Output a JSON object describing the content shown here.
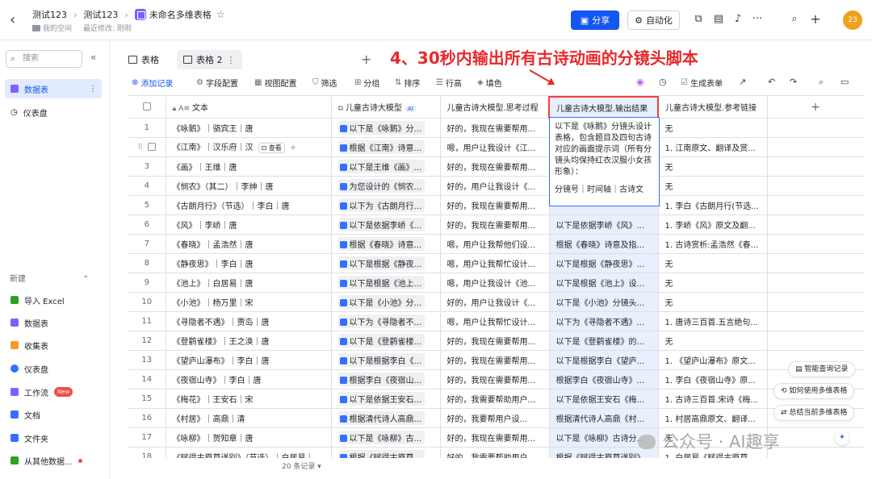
{
  "header": {
    "crumbs": [
      "测试123",
      "测试123",
      "未命名多维表格"
    ],
    "location": "我的空间",
    "modified": "最近修改: 刚刚",
    "share_label": "分享",
    "automation_label": "自动化",
    "avatar_text": "23"
  },
  "sidebar": {
    "search_placeholder": "搜索",
    "items": [
      {
        "label": "数据表",
        "color": "#7b61ff"
      },
      {
        "label": "仪表盘",
        "color": "#1f2329"
      }
    ],
    "new_label": "新建",
    "new_items": [
      {
        "label": "导入 Excel",
        "color": "#2ea121"
      },
      {
        "label": "数据表",
        "color": "#7b61ff"
      },
      {
        "label": "收集表",
        "color": "#f59a23"
      },
      {
        "label": "仪表盘",
        "color": "#3370ff"
      },
      {
        "label": "工作流",
        "color": "#7b61ff"
      },
      {
        "label": "文档",
        "color": "#3370ff"
      },
      {
        "label": "文件夹",
        "color": "#3370ff"
      },
      {
        "label": "从其他数据...",
        "color": "#2ea121"
      }
    ],
    "new_badge": "New"
  },
  "tabs": [
    {
      "label": "表格"
    },
    {
      "label": "表格 2"
    }
  ],
  "toolbar": {
    "add_record": "添加记录",
    "field_config": "字段配置",
    "view_config": "视图配置",
    "filter": "筛选",
    "group": "分组",
    "sort": "排序",
    "row_height": "行高",
    "fill_color": "填色",
    "generate_form": "生成表单"
  },
  "annotation": "4、30秒内输出所有古诗动画的分镜头脚本",
  "table": {
    "columns": [
      "文本",
      "儿童古诗大模型",
      "儿童古诗大模型.思考过程",
      "儿童古诗大模型.输出结果",
      "儿童古诗大模型.参考链接"
    ],
    "ai_tag": "AI",
    "view_label": "查看",
    "rows": [
      {
        "n": "1",
        "text": "《咏鹅》｜骆宾王｜唐",
        "model": "以下是《咏鹅》分...",
        "think": "好的，我现在需要帮用...",
        "out": "",
        "link": "无"
      },
      {
        "n": "",
        "text": "《江南》｜汉乐府｜汉",
        "model": "根据《江南》诗意...",
        "think": "嗯，用户让我设计《江...",
        "out": "",
        "link": "1. 江南原文、翻译及赏..."
      },
      {
        "n": "3",
        "text": "《画》｜王维｜唐",
        "model": "以下是王维《画》...",
        "think": "好的，我现在需要帮用...",
        "out": "",
        "link": "无"
      },
      {
        "n": "4",
        "text": "《悯农》（其二）｜李绅｜唐",
        "model": "为您设计的《悯农...",
        "think": "好的，用户让我设计《...",
        "out": "",
        "link": "无"
      },
      {
        "n": "5",
        "text": "《古朗月行》（节选）｜李白｜唐",
        "model": "以下为《古朗月行...",
        "think": "好的，我现在需要帮用...",
        "out": "",
        "link": "1. 李白《古朗月行(节选..."
      },
      {
        "n": "6",
        "text": "《风》｜李峤｜唐",
        "model": "以下是依据李峤《...",
        "think": "好的，我现在需要帮用...",
        "out": "以下是依据李峤《风》...",
        "link": "1. 李峤《风》原文及翻..."
      },
      {
        "n": "7",
        "text": "《春晓》｜孟浩然｜唐",
        "model": "根据《春晓》诗意...",
        "think": "嗯，用户让我帮他们设...",
        "out": "根据《春晓》诗意及指...",
        "link": "1. 古诗赏析:孟浩然《春..."
      },
      {
        "n": "8",
        "text": "《静夜思》｜李白｜唐",
        "model": "以下是根据《静夜...",
        "think": "嗯，用户让我帮忙设计...",
        "out": "以下是根据《静夜思》...",
        "link": "无"
      },
      {
        "n": "9",
        "text": "《池上》｜白居易｜唐",
        "model": "以下是根据《池上...",
        "think": "嗯，用户让我设计《池...",
        "out": "以下是根据《池上》设...",
        "link": "无"
      },
      {
        "n": "10",
        "text": "《小池》｜杨万里｜宋",
        "model": "以下是《小池》分...",
        "think": "好的，用户让我设计《...",
        "out": "以下是《小池》分镜头...",
        "link": "无"
      },
      {
        "n": "11",
        "text": "《寻隐者不遇》｜贾岛｜唐",
        "model": "以下为《寻隐者不...",
        "think": "嗯，用户让我帮忙设计...",
        "out": "以下为《寻隐者不遇》...",
        "link": "1. 唐诗三百首.五言绝句..."
      },
      {
        "n": "12",
        "text": "《登鹳雀楼》｜王之涣｜唐",
        "model": "以下是《登鹳雀楼...",
        "think": "好的，我现在需要帮用...",
        "out": "以下是《登鹳雀楼》的...",
        "link": "无"
      },
      {
        "n": "13",
        "text": "《望庐山瀑布》｜李白｜唐",
        "model": "以下是根据李白《...",
        "think": "好的，我现在需要帮用...",
        "out": "以下是根据李白《望庐...",
        "link": "1. 《望庐山瀑布》原文..."
      },
      {
        "n": "14",
        "text": "《夜宿山寺》｜李白｜唐",
        "model": "根据李白《夜宿山...",
        "think": "好的，我现在需要帮用...",
        "out": "根据李白《夜宿山寺》...",
        "link": "1. 李白《夜宿山寺》原..."
      },
      {
        "n": "15",
        "text": "《梅花》｜王安石｜宋",
        "model": "以下是依据王安石...",
        "think": "好的，我需要帮助用户...",
        "out": "以下是依据王安石《梅...",
        "link": "1. 古诗三百首.宋诗《梅..."
      },
      {
        "n": "16",
        "text": "《村居》｜高鼎｜清",
        "model": "根据清代诗人高鼎...",
        "think": "好的，我要帮用户设...",
        "out": "根据清代诗人高鼎《村...",
        "link": "1. 村居高鼎原文、翻译..."
      },
      {
        "n": "17",
        "text": "《咏柳》｜贺知章｜唐",
        "model": "以下是《咏柳》古...",
        "think": "好的，我现在需要帮用...",
        "out": "以下是《咏柳》古诗分...",
        "link": "无"
      },
      {
        "n": "18",
        "text": "《赋得古原草送别》（节选）｜白居易｜",
        "model": "根据《赋得古原草...",
        "think": "好的，我需要帮助用户...",
        "out": "根据《赋得古原草送别》",
        "link": "1. 白居易《赋得古原草..."
      }
    ]
  },
  "popup_lines": [
    "以下是《咏鹅》分镜头设计表格，包含题目及四句古诗对应的画面提示词（所有分镜头均保持红衣汉服小女孩形象）：",
    "分镜号｜时间轴｜古诗文"
  ],
  "footer": {
    "records": "20 条记录"
  },
  "float_buttons": [
    "智能查询记录",
    "如何使用多维表格",
    "总结当前多维表格"
  ],
  "watermark": "公众号 · AI趣享"
}
